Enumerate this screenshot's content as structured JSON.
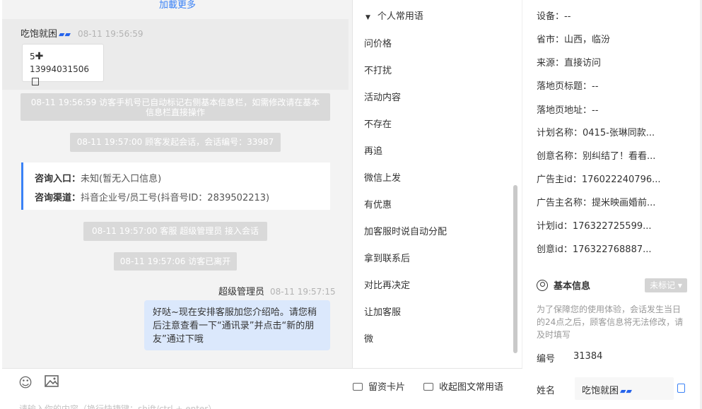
{
  "chat": {
    "load_more": "加載更多",
    "customer": {
      "name": "吃饱就困",
      "time": "08-11 19:56:59",
      "card_line1": "5",
      "card_line2": "13994031506"
    },
    "system_messages": [
      "08-11 19:56:59 访客手机号已自动标记右侧基本信息栏，如需修改请在基本信息栏直接操作",
      "08-11 19:57:00 顾客发起会话，会话编号：33987",
      "08-11 19:57:00 客服 超级管理员 接入会话",
      "08-11 19:57:06 访客已离开"
    ],
    "consult": {
      "entry_label": "咨询入口：",
      "entry_value": "未知(暂无入口信息)",
      "channel_label": "咨询渠道：",
      "channel_value": "抖音企业号/员工号(抖音号ID：2839502213)"
    },
    "agent": {
      "name": "超级管理员",
      "time": "08-11 19:57:15",
      "message": "好哒~现在安排客服加您介绍哈。请您稍后注意查看一下“通讯录”并点击“新的朋友”通过下哦"
    },
    "input_placeholder": "请输入你的内容（换行快捷键：shift/ctrl + enter）"
  },
  "phrases": {
    "title": "个人常用语",
    "items": [
      "问价格",
      "不打扰",
      "活动内容",
      "不存在",
      "再追",
      "微信上发",
      "有优惠",
      "加客服时说自动分配",
      "拿到联系后",
      "对比再决定",
      "让加客服",
      "微"
    ],
    "footer_left": "留资卡片",
    "footer_right": "收起图文常用语"
  },
  "info": {
    "rows": [
      "设备：--",
      "省市：山西，临汾",
      "来源：直接访问",
      "落地页标题：--",
      "落地页地址：--",
      "计划名称：0415-张琳同款...",
      "创意名称：别纠结了！看看...",
      "广告主id：176022240796...",
      "广告主名称：提米映画婚前...",
      "计划id：176322725599...",
      "创意id：176322768887..."
    ],
    "basic_title": "基本信息",
    "tag_button": "未标记",
    "notice": "为了保障您的使用体验，会话发生当日的24点之后，顾客信息将无法修改，请及时填写",
    "number_label": "编号",
    "number_value": "31384",
    "name_label": "姓名",
    "name_value": "吃饱就困"
  }
}
